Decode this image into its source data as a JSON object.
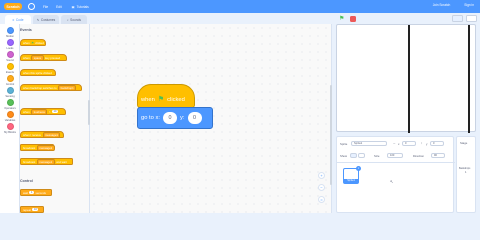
{
  "menubar": {
    "logo": "Scratch",
    "file": "File",
    "edit": "Edit",
    "tutorials": "Tutorials",
    "join": "Join Scratch",
    "signin": "Sign in"
  },
  "tabs": [
    {
      "label": "Code",
      "icon": "code-icon"
    },
    {
      "label": "Costumes",
      "icon": "costume-icon"
    },
    {
      "label": "Sounds",
      "icon": "sound-icon"
    }
  ],
  "categories": [
    {
      "label": "Motion",
      "color": "#4c97ff"
    },
    {
      "label": "Looks",
      "color": "#9966ff"
    },
    {
      "label": "Sound",
      "color": "#cf63cf"
    },
    {
      "label": "Events",
      "color": "#ffbf00"
    },
    {
      "label": "Control",
      "color": "#ffab19"
    },
    {
      "label": "Sensing",
      "color": "#5cb1d6"
    },
    {
      "label": "Operators",
      "color": "#59c059"
    },
    {
      "label": "Variables",
      "color": "#ff8c1a"
    },
    {
      "label": "My Blocks",
      "color": "#ff6680"
    }
  ],
  "palette": {
    "events_title": "Events",
    "control_title": "Control",
    "blocks": [
      {
        "text": "when",
        "suffix": "clicked"
      },
      {
        "text": "when",
        "dd": "space",
        "suffix": "key pressed"
      },
      {
        "text": "when this sprite clicked"
      },
      {
        "text": "when backdrop switches to",
        "dd": "backdrop1"
      },
      {
        "text": "when",
        "dd": "loudness",
        "pill": "10"
      },
      {
        "text": "when I receive",
        "dd": "message1"
      },
      {
        "text": "broadcast",
        "dd": "message1"
      },
      {
        "text": "broadcast",
        "dd": "message1",
        "suffix": "and wait"
      },
      {
        "text": "wait",
        "pill": "1",
        "suffix": "seconds"
      },
      {
        "text": "repeat",
        "pill": "10"
      }
    ]
  },
  "workspace": {
    "hat_when": "when",
    "hat_clicked": "clicked",
    "goto_label": "go to x:",
    "x_value": "0",
    "y_label": "y:",
    "y_value": "0",
    "zoom_in": "+",
    "zoom_out": "−",
    "zoom_reset": "="
  },
  "sprite_info": {
    "sprite_label": "Sprite",
    "sprite_name": "Sprite1",
    "x_label": "x",
    "x_value": "0",
    "y_label": "y",
    "y_value": "0",
    "show_label": "Show",
    "size_label": "Size",
    "size_value": "100",
    "direction_label": "Direction",
    "direction_value": "90"
  },
  "sprite_list": [
    {
      "name": "Sprite1"
    }
  ],
  "stage_pane": {
    "title": "Stage",
    "backdrops_label": "Backdrops",
    "backdrops_count": "1"
  }
}
